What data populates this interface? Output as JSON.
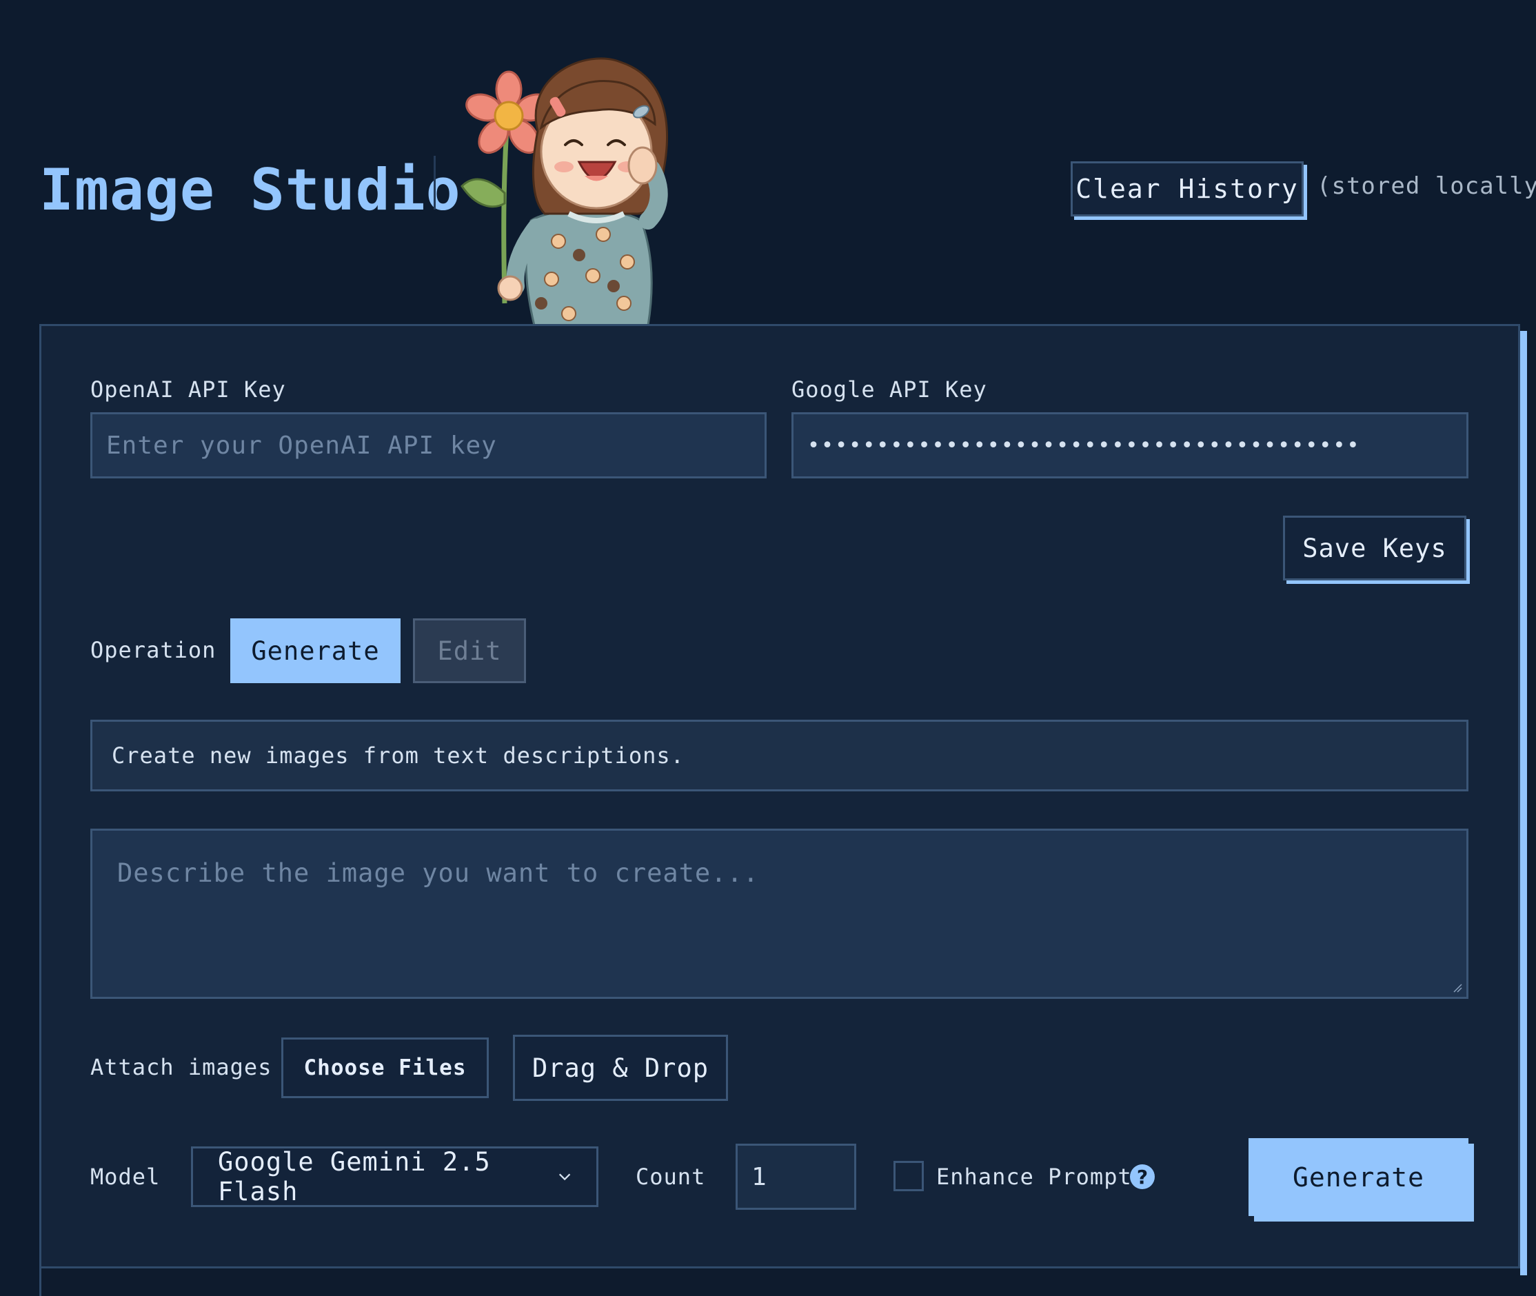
{
  "header": {
    "title": "Image Studio",
    "clear_history_label": "Clear History",
    "stored_note": "(stored locally)"
  },
  "keys": {
    "openai_label": "OpenAI API Key",
    "openai_placeholder": "Enter your OpenAI API key",
    "google_label": "Google API Key",
    "google_value_masked": "••••••••••••••••••••••••••••••••••••••••",
    "save_label": "Save Keys"
  },
  "operation": {
    "label": "Operation",
    "options": [
      "Generate",
      "Edit"
    ],
    "selected": "Generate",
    "description": "Create new images from text descriptions."
  },
  "prompt": {
    "placeholder": "Describe the image you want to create..."
  },
  "attach": {
    "label": "Attach images",
    "choose_files_label": "Choose Files",
    "drag_drop_label": "Drag & Drop"
  },
  "controls": {
    "model_label": "Model",
    "model_value": "Google Gemini 2.5 Flash",
    "count_label": "Count",
    "count_value": "1",
    "enhance_label": "Enhance Prompt",
    "help_glyph": "?",
    "generate_label": "Generate"
  },
  "colors": {
    "accent": "#93c5fd",
    "background": "#0d1b2e",
    "panel": "#14243a"
  }
}
